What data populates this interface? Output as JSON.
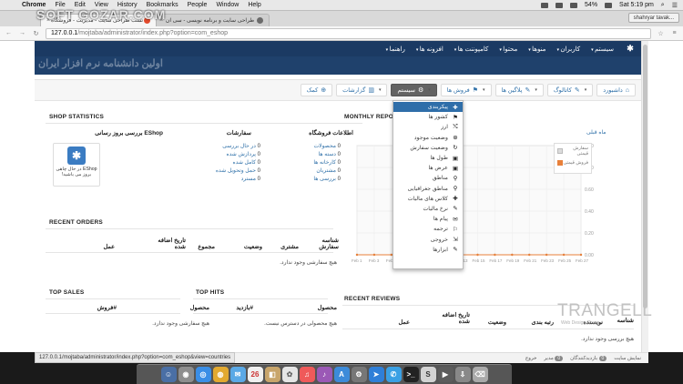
{
  "os": {
    "app": "Chrome",
    "menus": [
      "File",
      "Edit",
      "View",
      "History",
      "Bookmarks",
      "People",
      "Window",
      "Help"
    ],
    "battery": "54%",
    "clock": "Sat 5:19 pm"
  },
  "browser": {
    "tabs": [
      {
        "title": "تست طراحی سایت - مدیریت - فروشگاه",
        "active": true
      },
      {
        "title": "طراحی سایت و برنامه نویسی - سی ان",
        "active": false
      }
    ],
    "profile": "shahryar tavak...",
    "url_domain": "127.0.0.1",
    "url_path": "/mojtaba/administrator/index.php?option=com_eshop",
    "hover_link": "127.0.0.1/mojtaba/administrator/index.php?option=com_eshop&view=countries"
  },
  "watermark": {
    "line1": "SOFT GOZAR.COM",
    "line2": "اولین دانشنامه نرم افزار ایران"
  },
  "topnav": {
    "items": [
      "سیستم",
      "کاربران",
      "منوها",
      "محتوا",
      "کامپوننت ها",
      "افزونه ها",
      "راهنما"
    ]
  },
  "toolbar": {
    "buttons": [
      {
        "label": "داشبورد",
        "icon": "home-icon",
        "glyph": "⌂"
      },
      {
        "label": "کاتالوگ",
        "icon": "pencil-icon",
        "glyph": "✎"
      },
      {
        "label": "پلاگین ها",
        "icon": "pencil-icon",
        "glyph": "✎"
      },
      {
        "label": "فروش ها",
        "icon": "flag-icon",
        "glyph": "⚑"
      },
      {
        "label": "سیستم",
        "icon": "gear-icon",
        "glyph": "⚙"
      },
      {
        "label": "گزارشات",
        "icon": "chart-icon",
        "glyph": "▥"
      },
      {
        "label": "کمک",
        "icon": "help-icon",
        "glyph": "⊕"
      }
    ]
  },
  "dropdown": {
    "items": [
      {
        "label": "پیکربندی",
        "glyph": "✚",
        "icon": "config-icon",
        "active": true
      },
      {
        "label": "کشور ها",
        "glyph": "⚑",
        "icon": "flag-icon"
      },
      {
        "label": "ارز",
        "glyph": "⤭",
        "icon": "shuffle-icon"
      },
      {
        "label": "وضعیت موجود",
        "glyph": "⊕",
        "icon": "stock-icon"
      },
      {
        "label": "وضعیت سفارش",
        "glyph": "↻",
        "icon": "refresh-icon"
      },
      {
        "label": "طول ها",
        "glyph": "▣",
        "icon": "ruler-icon"
      },
      {
        "label": "عرض ها",
        "glyph": "▣",
        "icon": "width-icon"
      },
      {
        "label": "مناطق",
        "glyph": "⚲",
        "icon": "location-icon"
      },
      {
        "label": "مناطق جغرافیایی",
        "glyph": "⚲",
        "icon": "map-pin-icon"
      },
      {
        "label": "کلاس های مالیات",
        "glyph": "✚",
        "icon": "tax-class-icon"
      },
      {
        "label": "نرخ مالیات",
        "glyph": "✎",
        "icon": "edit-icon"
      },
      {
        "label": "پیام ها",
        "glyph": "✉",
        "icon": "message-icon"
      },
      {
        "label": "ترجمه",
        "glyph": "⚐",
        "icon": "translate-icon"
      },
      {
        "label": "خروجی",
        "glyph": "⇲",
        "icon": "export-icon"
      },
      {
        "label": "ابزارها",
        "glyph": "✎",
        "icon": "tools-icon"
      }
    ]
  },
  "shop_stats": {
    "title": "SHOP STATISTICS",
    "store_info": {
      "title": "اطلاعات فروشگاه",
      "rows": [
        {
          "n": "0",
          "label": "محصولات"
        },
        {
          "n": "0",
          "label": "دسته ها"
        },
        {
          "n": "0",
          "label": "کارخانه ها"
        },
        {
          "n": "0",
          "label": "مشتریان"
        },
        {
          "n": "0",
          "label": "بررسی ها"
        }
      ]
    },
    "orders": {
      "title": "سفارشات",
      "rows": [
        {
          "n": "0",
          "label": "در حال بررسی"
        },
        {
          "n": "0",
          "label": "پردازش شده"
        },
        {
          "n": "0",
          "label": "کامل شده"
        },
        {
          "n": "0",
          "label": "حمل وتحویل شده"
        },
        {
          "n": "0",
          "label": "مسترد"
        }
      ]
    },
    "update": {
      "title": "EShop بررسی بروز رسانی",
      "caption": "EShop در حال چاهی بروز می باشید!"
    }
  },
  "monthly_report": {
    "title": "MONTHLY REPORT",
    "month_select": "ماه قبلی",
    "legend": [
      {
        "label": "سفارش قیمتی",
        "color": "#dcdcdc"
      },
      {
        "label": "فروش قیمتی",
        "color": "#e8803a"
      }
    ]
  },
  "chart_data": {
    "type": "line",
    "x": [
      "Feb 1",
      "Feb 3",
      "Feb 5",
      "Feb 7",
      "Feb 9",
      "Feb 11",
      "Feb 13",
      "Feb 15",
      "Feb 17",
      "Feb 19",
      "Feb 21",
      "Feb 23",
      "Feb 25",
      "Feb 27"
    ],
    "series": [
      {
        "values": [
          0,
          0,
          0,
          0,
          0,
          0,
          0,
          0,
          0,
          0,
          0,
          0,
          0,
          0
        ]
      },
      {
        "values": [
          0,
          0,
          0,
          0,
          0,
          0,
          0,
          0,
          0,
          0,
          0,
          0,
          0,
          0
        ]
      }
    ],
    "yticks": [
      "1.00",
      "0.80",
      "0.60",
      "0.40",
      "0.20",
      "0.00"
    ],
    "ylim": [
      0,
      1
    ],
    "xlabel": "",
    "ylabel": "",
    "title": "MONTHLY REPORT",
    "grid": true
  },
  "recent_orders": {
    "title": "RECENT ORDERS",
    "headers": [
      "شناسه سفارش",
      "مشتری",
      "وضعیت",
      "مجموع",
      "تاریخ اضافه شده",
      "عمل"
    ],
    "empty": "هیچ سفارشی وجود ندارد."
  },
  "recent_reviews": {
    "title": "RECENT REVIEWS",
    "headers": [
      "شناسه",
      "نویسنده",
      "رتبه بندی",
      "وضعیت",
      "تاریخ اضافه شده",
      "عمل"
    ],
    "empty": "هیچ بررسی وجود ندارد."
  },
  "top_sales": {
    "title": "TOP SALES",
    "headers": [
      "محصول",
      "#فروش"
    ],
    "empty": "هیچ سفارشی وجود ندارد."
  },
  "top_hits": {
    "title": "TOP HITS",
    "headers": [
      "محصول",
      "#بازدید"
    ],
    "empty": "هیچ محصولی در دسترس نیست."
  },
  "brand": {
    "name": "TRANGELL",
    "sub": "Web Design Group"
  },
  "status": {
    "items": [
      {
        "label": "نمایش سایت"
      },
      {
        "label": "بازدیدکنندگان",
        "n": "0"
      },
      {
        "label": "مدیر",
        "n": "0"
      },
      {
        "label": "خروج"
      }
    ]
  }
}
